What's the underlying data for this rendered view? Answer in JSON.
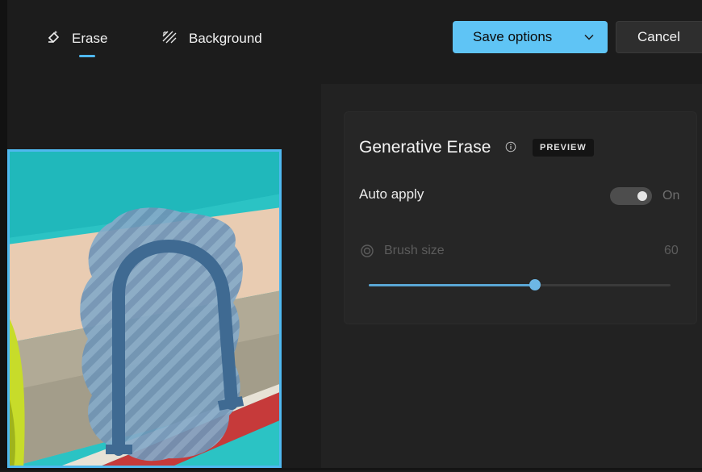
{
  "toolbar": {
    "tabs": [
      {
        "label": "Erase",
        "icon": "erase-icon",
        "active": true
      },
      {
        "label": "Background",
        "icon": "background-icon",
        "active": false
      }
    ],
    "save_label": "Save options",
    "cancel_label": "Cancel"
  },
  "panel": {
    "title": "Generative Erase",
    "badge": "PREVIEW",
    "auto_apply": {
      "label": "Auto apply",
      "state": "On",
      "enabled": true
    },
    "brush": {
      "label": "Brush size",
      "value": "60",
      "fraction": 0.55
    }
  },
  "colors": {
    "accent": "#5fc4f5",
    "selection_border": "#4fb8ef",
    "mask_overlay": "#6f9bc4"
  }
}
